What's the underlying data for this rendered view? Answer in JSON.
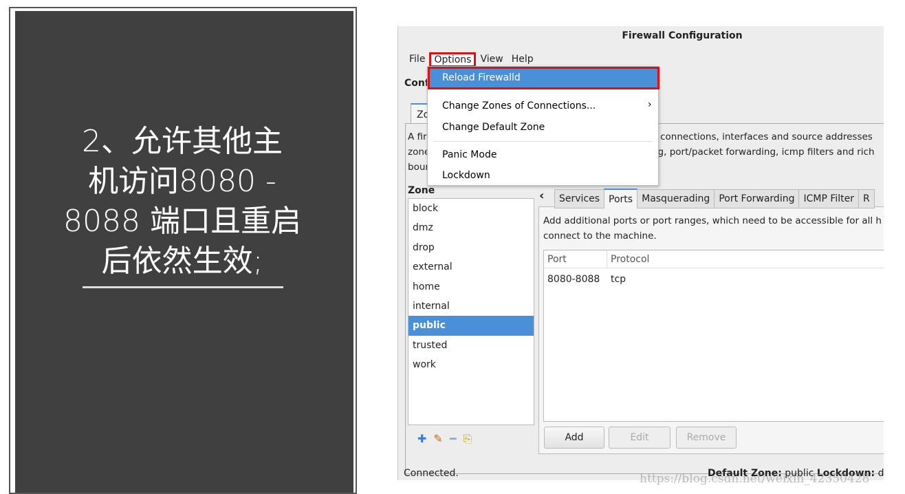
{
  "slide": {
    "lines": [
      "2、允许其他主",
      "机访问8080 -",
      "8088 端口且重启",
      "后依然生效;"
    ]
  },
  "window": {
    "title": "Firewall Configuration",
    "menubar": [
      "File",
      "Options",
      "View",
      "Help"
    ],
    "config_label": "Conf",
    "zone_tab": "Zo",
    "description": [
      "A fir",
      "zone",
      "bour"
    ],
    "description_right": [
      "k connections, interfaces and source addresses",
      "ng, port/packet forwarding, icmp filters and rich"
    ],
    "zone_label": "Zone",
    "zones": [
      "block",
      "dmz",
      "drop",
      "external",
      "home",
      "internal",
      "public",
      "trusted",
      "work"
    ],
    "selected_zone": "public",
    "tabs": [
      "Services",
      "Ports",
      "Masquerading",
      "Port Forwarding",
      "ICMP Filter",
      "R"
    ],
    "active_tab": "Ports",
    "ports_description": [
      "Add additional ports or port ranges, which need to be accessible for all h",
      "connect to the machine."
    ],
    "table": {
      "headers": [
        "Port",
        "Protocol"
      ],
      "rows": [
        [
          "8080-8088",
          "tcp"
        ]
      ]
    },
    "buttons": {
      "add": "Add",
      "edit": "Edit",
      "remove": "Remove"
    },
    "status": {
      "left": "Connected.",
      "default_zone_label": "Default Zone:",
      "default_zone": "public",
      "lockdown_label": "Lockdown:",
      "lockdown": "di"
    }
  },
  "options_menu": {
    "items": [
      "Reload Firewalld",
      "Change Zones of Connections...",
      "Change Default Zone",
      "Panic Mode",
      "Lockdown"
    ],
    "highlighted": "Reload Firewalld",
    "submenu_arrow": "›"
  },
  "watermark": "https://blog.csdn.net/weixin_42350428",
  "colors": {
    "highlight": "#4a90d9",
    "annotation_red": "#e01010",
    "slide_bg": "#404040"
  }
}
